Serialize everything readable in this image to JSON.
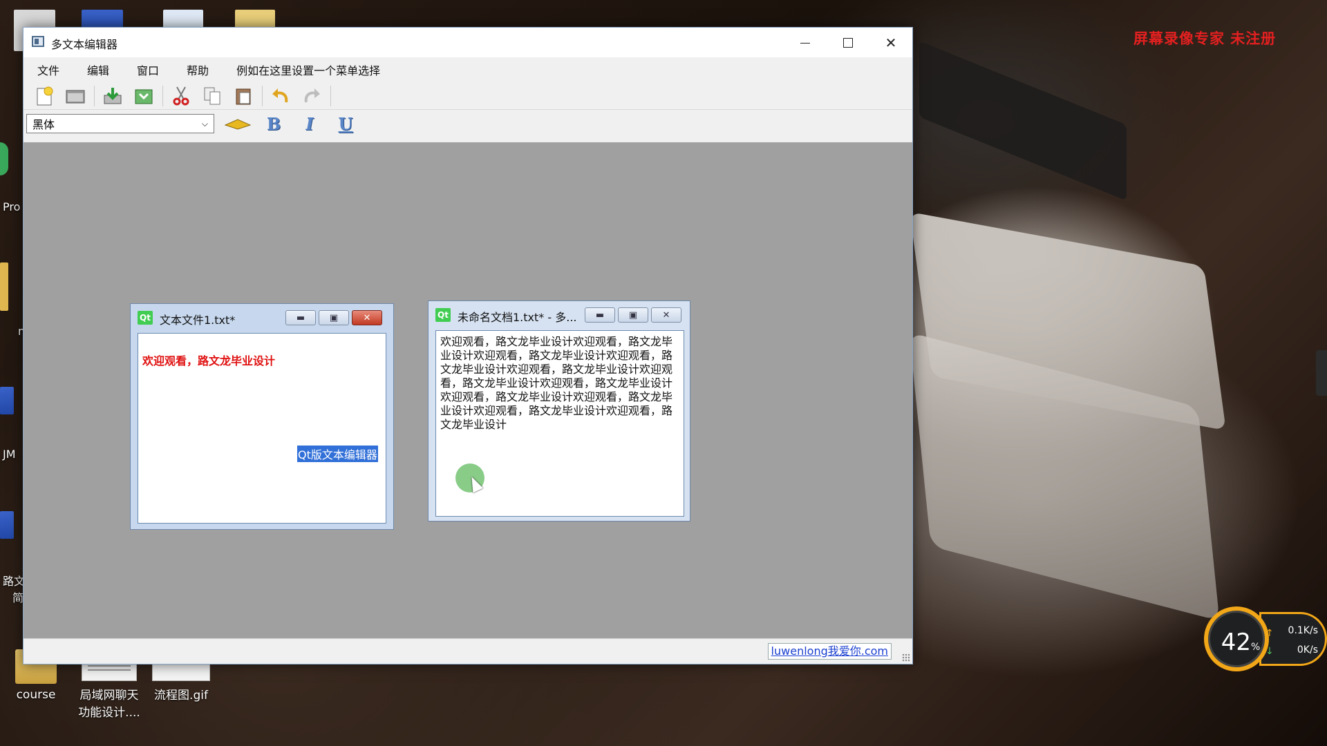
{
  "desktop": {
    "watermark": "屏幕录像专家  未注册",
    "icons": [
      {
        "label": "course"
      },
      {
        "label": "局域网聊天功能设计...."
      },
      {
        "label": "流程图.gif"
      }
    ],
    "left_clipped_labels": [
      "Pro",
      "m",
      "JM",
      "路文",
      "简"
    ]
  },
  "main_window": {
    "title": "多文本编辑器",
    "menu": [
      "文件",
      "编辑",
      "窗口",
      "帮助",
      "例如在这里设置一个菜单选择"
    ],
    "toolbar_icons": [
      "new-file-icon",
      "open-folder-icon",
      "save-icon",
      "save-as-icon",
      "cut-icon",
      "copy-icon",
      "paste-icon",
      "undo-icon",
      "redo-icon"
    ],
    "font_select_value": "黑体",
    "format_buttons": {
      "bold": "B",
      "italic": "I",
      "underline": "U"
    },
    "status_link": "luwenlong我爱你.com"
  },
  "children": [
    {
      "title": "文本文件1.txt*",
      "line1": "欢迎观看，路文龙毕业设计",
      "selected_text": "Qt版文本编辑器"
    },
    {
      "title": "未命名文档1.txt* - 多...",
      "body": "欢迎观看，路文龙毕业设计欢迎观看，路文龙毕业设计欢迎观看，路文龙毕业设计欢迎观看，路文龙毕业设计欢迎观看，路文龙毕业设计欢迎观看，路文龙毕业设计欢迎观看，路文龙毕业设计欢迎观看，路文龙毕业设计欢迎观看，路文龙毕业设计欢迎观看，路文龙毕业设计欢迎观看，路文龙毕业设计"
    }
  ],
  "speed_widget": {
    "percent": "42",
    "percent_unit": "%",
    "upload": "0.1K/s",
    "download": "0K/s"
  },
  "colors": {
    "accent_orange": "#f2a718",
    "watermark_red": "#e32020",
    "mdi_background": "#a0a0a0",
    "selection_blue": "#3170d8"
  }
}
